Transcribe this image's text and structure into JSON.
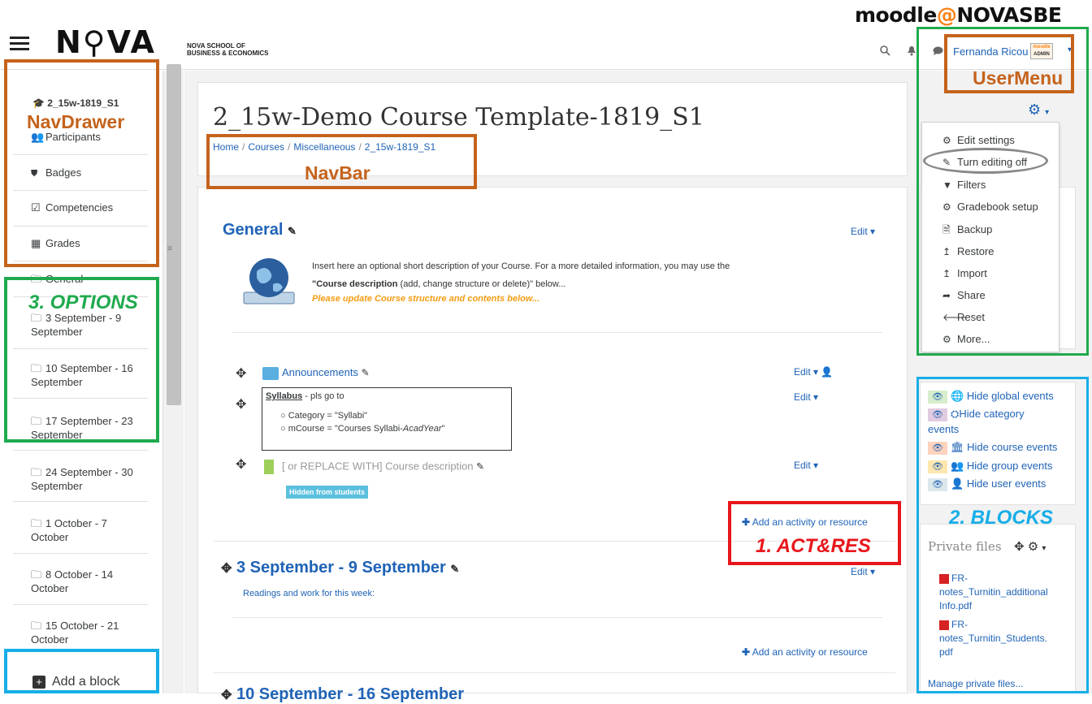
{
  "header": {
    "logo_text": "N⚲VA",
    "logo_sub_line1": "NOVA SCHOOL OF",
    "logo_sub_line2": "BUSINESS & ECONOMICS",
    "brand_moodle": "moodle",
    "brand_at": "@",
    "brand_novasbe": "NOVASBE",
    "user_name": "Fernanda Ricou",
    "avatar_text_top": "moodle",
    "avatar_text_bottom": "ADMIN",
    "icons": [
      "search-icon",
      "bell-icon",
      "chat-icon",
      "caret-down-icon"
    ]
  },
  "drawer": {
    "course_short": "2_15w-1819_S1",
    "items": [
      {
        "label": "Participants",
        "icon": "users-icon"
      },
      {
        "label": "Badges",
        "icon": "badge-icon"
      },
      {
        "label": "Competencies",
        "icon": "checkbox-icon"
      },
      {
        "label": "Grades",
        "icon": "table-icon"
      },
      {
        "label": "General",
        "icon": "folder-icon"
      },
      {
        "label": "3 September - 9 September",
        "icon": "folder-icon"
      },
      {
        "label": "10 September - 16 September",
        "icon": "folder-icon"
      },
      {
        "label": "17 September - 23 September",
        "icon": "folder-icon"
      },
      {
        "label": "24 September - 30 September",
        "icon": "folder-icon"
      },
      {
        "label": "1 October - 7 October",
        "icon": "folder-icon"
      },
      {
        "label": "8 October - 14 October",
        "icon": "folder-icon"
      },
      {
        "label": "15 October - 21 October",
        "icon": "folder-icon"
      }
    ],
    "add_block": "Add a block"
  },
  "page": {
    "title": "2_15w-Demo Course Template-1819_S1",
    "breadcrumb": [
      "Home",
      "Courses",
      "Miscellaneous",
      "2_15w-1819_S1"
    ]
  },
  "course": {
    "general_title": "General",
    "edit_label": "Edit",
    "intro_line1": "Insert here an optional short description of your Course. For a more detailed information, you may use the",
    "intro_bold": "\"Course description",
    "intro_rest": " (add, change structure or delete)\" below...",
    "intro_orange": "Please update Course structure and contents below...",
    "activities": [
      {
        "name": "Announcements"
      },
      {
        "name": "Syllabus"
      },
      {
        "name": "[ or REPLACE WITH] Course description"
      }
    ],
    "syllabus_suffix": " - pls go to",
    "syllabus_bullet1": "Category = \"Syllabi\"",
    "syllabus_bullet2_pre": "mCourse = \"Courses Syllabi-",
    "syllabus_bullet2_em": "AcadYear",
    "syllabus_bullet2_post": "\"",
    "hidden_badge": "Hidden from students",
    "add_activity": "Add an activity or resource",
    "section2_title": "3 September - 9 September",
    "section2_summary": "Readings and work for this week:",
    "section3_title": "10 September - 16 September"
  },
  "settings_menu": {
    "items": [
      {
        "label": "Edit settings",
        "icon": "gear-icon"
      },
      {
        "label": "Turn editing off",
        "icon": "pencil-icon"
      },
      {
        "label": "Filters",
        "icon": "filter-icon"
      },
      {
        "label": "Gradebook setup",
        "icon": "gear-icon"
      },
      {
        "label": "Backup",
        "icon": "file-icon"
      },
      {
        "label": "Restore",
        "icon": "upload-icon"
      },
      {
        "label": "Import",
        "icon": "upload-icon"
      },
      {
        "label": "Share",
        "icon": "share-icon"
      },
      {
        "label": "Reset",
        "icon": "arrow-left-icon"
      },
      {
        "label": "More...",
        "icon": "gear-icon"
      }
    ]
  },
  "calendar_block": {
    "events": [
      {
        "label": "Hide global events",
        "bg": "#d6eecb"
      },
      {
        "label": "Hide category",
        "bg": "#e0cbe0"
      },
      {
        "label": "Hide course events",
        "bg": "#ffd3bd"
      },
      {
        "label": "Hide group events",
        "bg": "#fee7ae"
      },
      {
        "label": "Hide user events",
        "bg": "#dce7ec"
      }
    ],
    "category_wrap": "events"
  },
  "private_files": {
    "title": "Private files",
    "files": [
      "FR-notes_Turnitin_additionalInfo.pdf",
      "FR-notes_Turnitin_Students.pdf"
    ],
    "file1_lines": [
      "FR-",
      "notes_Turnitin_additional",
      "Info.pdf"
    ],
    "file2_lines": [
      "FR-",
      "notes_Turnitin_Students.",
      "pdf"
    ],
    "manage": "Manage private files..."
  },
  "annotations": {
    "usermenu": "UserMenu",
    "navdrawer": "NavDrawer",
    "navbar": "NavBar",
    "options": "3. OPTIONS",
    "blocks": "2. BLOCKS",
    "actres": "1. ACT&RES"
  },
  "colors": {
    "brown": "#c5631c",
    "green": "#1faa4e",
    "blue": "#16aee8",
    "red": "#e8161b",
    "link": "#1f63b6",
    "orange_text": "#f39c12"
  }
}
